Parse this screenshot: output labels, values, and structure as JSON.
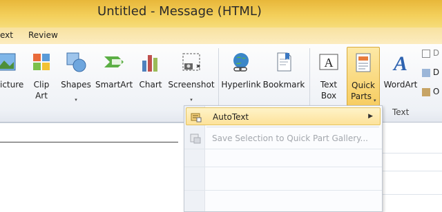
{
  "window": {
    "title": "Untitled  -  Message (HTML)"
  },
  "tabs": [
    {
      "label": "ext"
    },
    {
      "label": "Review"
    }
  ],
  "ribbon": {
    "buttons": {
      "picture": {
        "label": "icture"
      },
      "clip_art": {
        "label1": "Clip",
        "label2": "Art"
      },
      "shapes": {
        "label": "Shapes"
      },
      "smartart": {
        "label": "SmartArt"
      },
      "chart": {
        "label": "Chart"
      },
      "screenshot": {
        "label": "Screenshot"
      },
      "hyperlink": {
        "label": "Hyperlink"
      },
      "bookmark": {
        "label": "Bookmark"
      },
      "text_box": {
        "label1": "Text",
        "label2": "Box"
      },
      "quick_parts": {
        "label1": "Quick",
        "label2": "Parts"
      },
      "wordart": {
        "label": "WordArt"
      }
    },
    "groups": {
      "text": "Text"
    },
    "small_items": [
      "D",
      "D",
      "O"
    ],
    "caret": "▾"
  },
  "quick_parts_menu": {
    "items": [
      {
        "label": "AutoText",
        "has_submenu": true,
        "enabled": true,
        "submenu_arrow": "▶"
      },
      {
        "label": "Save Selection to Quick Part Gallery...",
        "enabled": false
      }
    ]
  },
  "colors": {
    "title_bar": "#f3cf5a",
    "active_button": "#f7cd62",
    "hover_item": "#fde29a"
  }
}
